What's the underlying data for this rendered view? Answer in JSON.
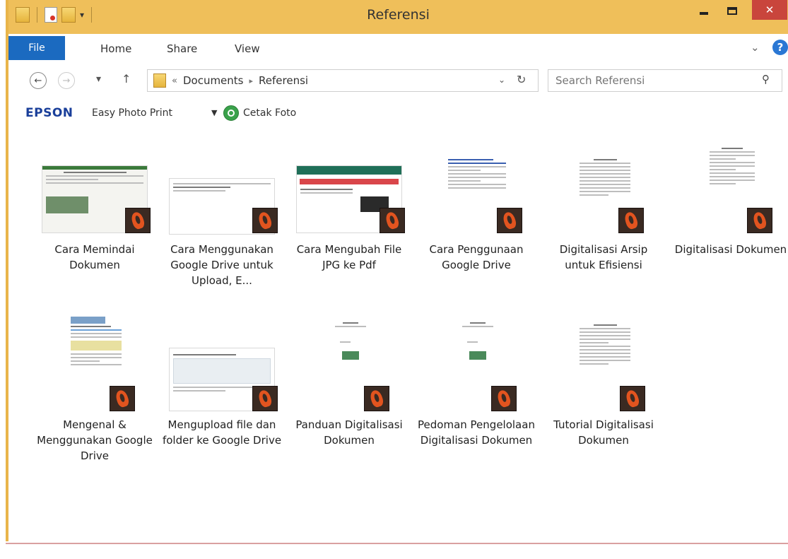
{
  "window": {
    "title": "Referensi"
  },
  "window_controls": {
    "close_glyph": "✕"
  },
  "ribbon": {
    "tabs": [
      {
        "label": "File"
      },
      {
        "label": "Home"
      },
      {
        "label": "Share"
      },
      {
        "label": "View"
      }
    ],
    "help_glyph": "?"
  },
  "address": {
    "overflow": "«",
    "crumbs": [
      "Documents",
      "Referensi"
    ],
    "separator": "▸"
  },
  "search": {
    "placeholder": "Search Referensi"
  },
  "epson_toolbar": {
    "brand": "EPSON",
    "app": "Easy Photo Print",
    "action": "Cetak Foto"
  },
  "files": [
    {
      "label": "Cara Memindai Dokumen",
      "type": "pdf"
    },
    {
      "label": "Cara Menggunakan Google Drive untuk Upload, E...",
      "type": "pdf"
    },
    {
      "label": "Cara Mengubah File JPG ke Pdf",
      "type": "pdf"
    },
    {
      "label": "Cara Penggunaan Google Drive",
      "type": "pdf"
    },
    {
      "label": "Digitalisasi Arsip untuk Efisiensi",
      "type": "pdf"
    },
    {
      "label": "Digitalisasi Dokumen",
      "type": "pdf"
    },
    {
      "label": "Mengenal & Menggunakan Google Drive",
      "type": "pdf"
    },
    {
      "label": "Mengupload file dan folder ke Google Drive",
      "type": "pdf"
    },
    {
      "label": "Panduan Digitalisasi Dokumen",
      "type": "pdf"
    },
    {
      "label": "Pedoman Pengelolaan Digitalisasi Dokumen",
      "type": "pdf"
    },
    {
      "label": "Tutorial Digitalisasi Dokumen",
      "type": "pdf"
    }
  ],
  "colors": {
    "titlebar": "#efbf5a",
    "file_tab": "#1b6ac0",
    "close_button": "#c9453c",
    "epson_brand": "#1a3f9a",
    "pdf_badge": "#e2541f"
  }
}
